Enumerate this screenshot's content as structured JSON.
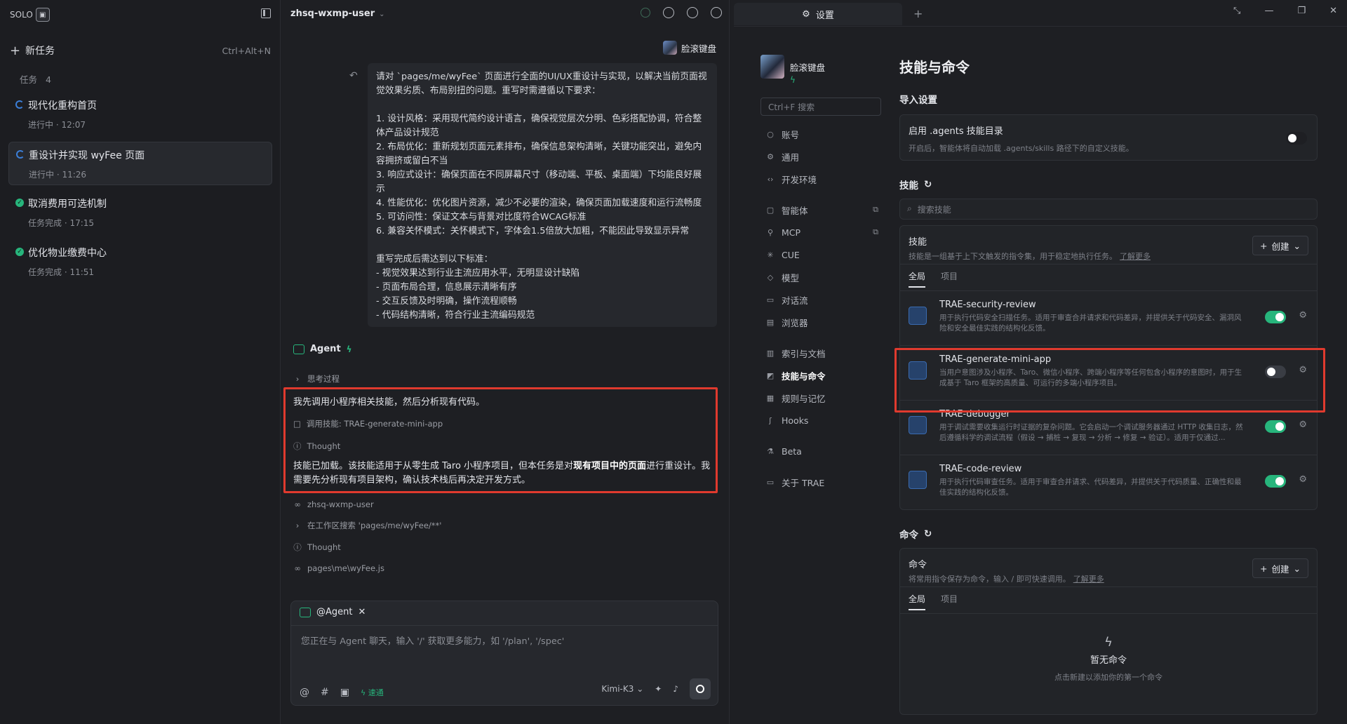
{
  "left": {
    "brand": "SOLO",
    "new_task": "新任务",
    "new_task_shortcut": "Ctrl+Alt+N",
    "task_label": "任务",
    "task_count": "4",
    "tasks": [
      {
        "title": "现代化重构首页",
        "status": "进行中 · 12:07",
        "state": "running"
      },
      {
        "title": "重设计并实现 wyFee 页面",
        "status": "进行中 · 11:26",
        "state": "running"
      },
      {
        "title": "取消费用可选机制",
        "status": "任务完成 · 17:15",
        "state": "done"
      },
      {
        "title": "优化物业缴费中心",
        "status": "任务完成 · 11:51",
        "state": "done"
      }
    ]
  },
  "chat": {
    "project": "zhsq-wxmp-user",
    "user_name": "脸滚键盘",
    "user_message": "请对 `pages/me/wyFee` 页面进行全面的UI/UX重设计与实现，以解决当前页面视觉效果劣质、布局别扭的问题。重写时需遵循以下要求：\n\n1. 设计风格：采用现代简约设计语言，确保视觉层次分明、色彩搭配协调，符合整体产品设计规范\n2. 布局优化：重新规划页面元素排布，确保信息架构清晰，关键功能突出，避免内容拥挤或留白不当\n3. 响应式设计：确保页面在不同屏幕尺寸（移动端、平板、桌面端）下均能良好展示\n4. 性能优化：优化图片资源，减少不必要的渲染，确保页面加载速度和运行流畅度\n5. 可访问性：保证文本与背景对比度符合WCAG标准\n6. 兼容关怀模式：关怀模式下，字体会1.5倍放大加粗，不能因此导致显示异常\n\n重写完成后需达到以下标准：\n- 视觉效果达到行业主流应用水平，无明显设计缺陷\n- 页面布局合理，信息展示清晰有序\n- 交互反馈及时明确，操作流程顺畅\n- 代码结构清晰，符合行业主流编码规范",
    "agent_label": "Agent",
    "thinking": "思考过程",
    "reply_intro": "我先调用小程序相关技能，然后分析现有代码。",
    "skill_call": "调用技能: TRAE-generate-mini-app",
    "thought_1": "Thought",
    "reply_para_a": "技能已加载。该技能适用于从零生成 Taro 小程序项目，但本任务是对",
    "reply_para_b": "现有项目中的页面",
    "reply_para_c": "进行重设计。我需要先分析现有项目架构，确认技术栈后再决定开发方式。",
    "step_repo": "zhsq-wxmp-user",
    "step_search": "在工作区搜索 'pages/me/wyFee/**'",
    "thought_2": "Thought",
    "step_file": "pages\\me\\wyFee.js",
    "input_tag": "@Agent",
    "input_placeholder": "您正在与 Agent 聊天，输入 '/' 获取更多能力，如 '/plan', '/spec'",
    "fast_label": "速通",
    "model": "Kimi-K3"
  },
  "settings": {
    "tab_title": "设置",
    "profile_name": "脸滚键盘",
    "search_placeholder": "Ctrl+F 搜索",
    "nav": [
      {
        "label": "账号",
        "icon": "user-icon"
      },
      {
        "label": "通用",
        "icon": "gear-icon"
      },
      {
        "label": "开发环境",
        "icon": "code-icon"
      },
      {
        "label": "智能体",
        "icon": "bot-icon",
        "ext": true
      },
      {
        "label": "MCP",
        "icon": "mcp-icon",
        "ext": true
      },
      {
        "label": "CUE",
        "icon": "cue-icon"
      },
      {
        "label": "模型",
        "icon": "cube-icon"
      },
      {
        "label": "对话流",
        "icon": "chat-icon"
      },
      {
        "label": "浏览器",
        "icon": "browser-icon"
      },
      {
        "label": "索引与文档",
        "icon": "index-icon"
      },
      {
        "label": "技能与命令",
        "icon": "skill-icon",
        "selected": true
      },
      {
        "label": "规则与记忆",
        "icon": "rule-icon"
      },
      {
        "label": "Hooks",
        "icon": "hook-icon"
      },
      {
        "label": "Beta",
        "icon": "beta-icon"
      },
      {
        "label": "关于 TRAE",
        "icon": "info-icon"
      }
    ],
    "page_title": "技能与命令",
    "import_title": "导入设置",
    "agents_dir_title": "启用 .agents 技能目录",
    "agents_dir_desc": "开启后，智能体将自动加载 .agents/skills 路径下的自定义技能。",
    "skills_title": "技能",
    "skills_search": "搜索技能",
    "skills_card_title": "技能",
    "skills_card_desc": "技能是一组基于上下文触发的指令集，用于稳定地执行任务。",
    "learn_more": "了解更多",
    "create": "创建",
    "tab_all": "全局",
    "tab_project": "项目",
    "skills": [
      {
        "name": "TRAE-security-review",
        "desc": "用于执行代码安全扫描任务。适用于审查合并请求和代码差异，并提供关于代码安全、漏洞风险和安全最佳实践的结构化反馈。",
        "enabled": true
      },
      {
        "name": "TRAE-generate-mini-app",
        "desc": "当用户意图涉及小程序、Taro、微信小程序、跨端小程序等任何包含小程序的意图时，用于生成基于 Taro 框架的高质量、可运行的多端小程序项目。",
        "enabled": false
      },
      {
        "name": "TRAE-debugger",
        "desc": "用于调试需要收集运行时证据的复杂问题。它会启动一个调试服务器通过 HTTP 收集日志，然后遵循科学的调试流程（假设 → 捕桩 → 复现 → 分析 → 修复 → 验证）。适用于仅通过...",
        "enabled": true
      },
      {
        "name": "TRAE-code-review",
        "desc": "用于执行代码审查任务。适用于审查合并请求、代码差异，并提供关于代码质量、正确性和最佳实践的结构化反馈。",
        "enabled": true
      }
    ],
    "commands_title": "命令",
    "commands_card_title": "命令",
    "commands_card_desc": "将常用指令保存为命令，输入 / 即可快速调用。",
    "empty_title": "暂无命令",
    "empty_desc": "点击新建以添加你的第一个命令",
    "colors": {
      "accent": "#27b57c",
      "highlight": "#e03a2e"
    }
  }
}
